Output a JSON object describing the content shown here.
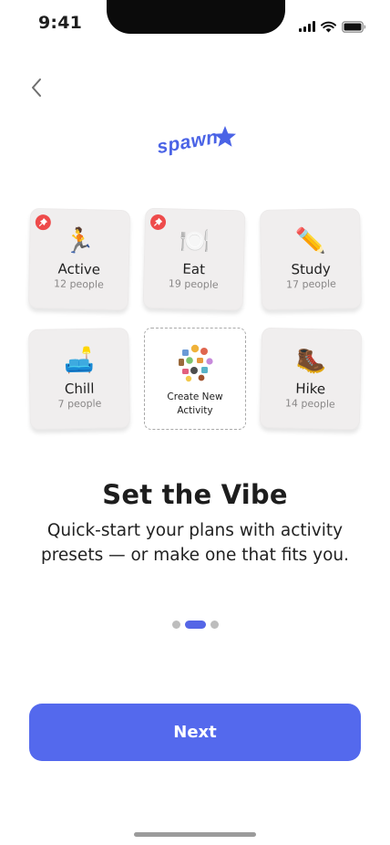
{
  "status_bar": {
    "time": "9:41"
  },
  "logo": {
    "text": "spawn",
    "color": "#4a63e6"
  },
  "tiles": [
    {
      "name": "Active",
      "count": "12 people",
      "emoji": "🏃",
      "pinned": true
    },
    {
      "name": "Eat",
      "count": "19 people",
      "emoji": "🍽️",
      "pinned": true
    },
    {
      "name": "Study",
      "count": "17 people",
      "emoji": "✏️",
      "pinned": false
    },
    {
      "name": "Chill",
      "count": "7 people",
      "emoji": "🛋️",
      "pinned": false
    },
    {
      "name": "Hike",
      "count": "14 people",
      "emoji": "🥾",
      "pinned": false
    }
  ],
  "create_new": {
    "label": "Create New Activity"
  },
  "onboarding": {
    "title": "Set the Vibe",
    "subtitle": "Quick-start your plans with activity presets — or make one that fits you."
  },
  "pagination": {
    "total": 3,
    "current": 2
  },
  "next_button": {
    "label": "Next"
  },
  "colors": {
    "accent": "#5469ed",
    "pin": "#ee4b4b",
    "tile_bg": "#f0eeee"
  }
}
